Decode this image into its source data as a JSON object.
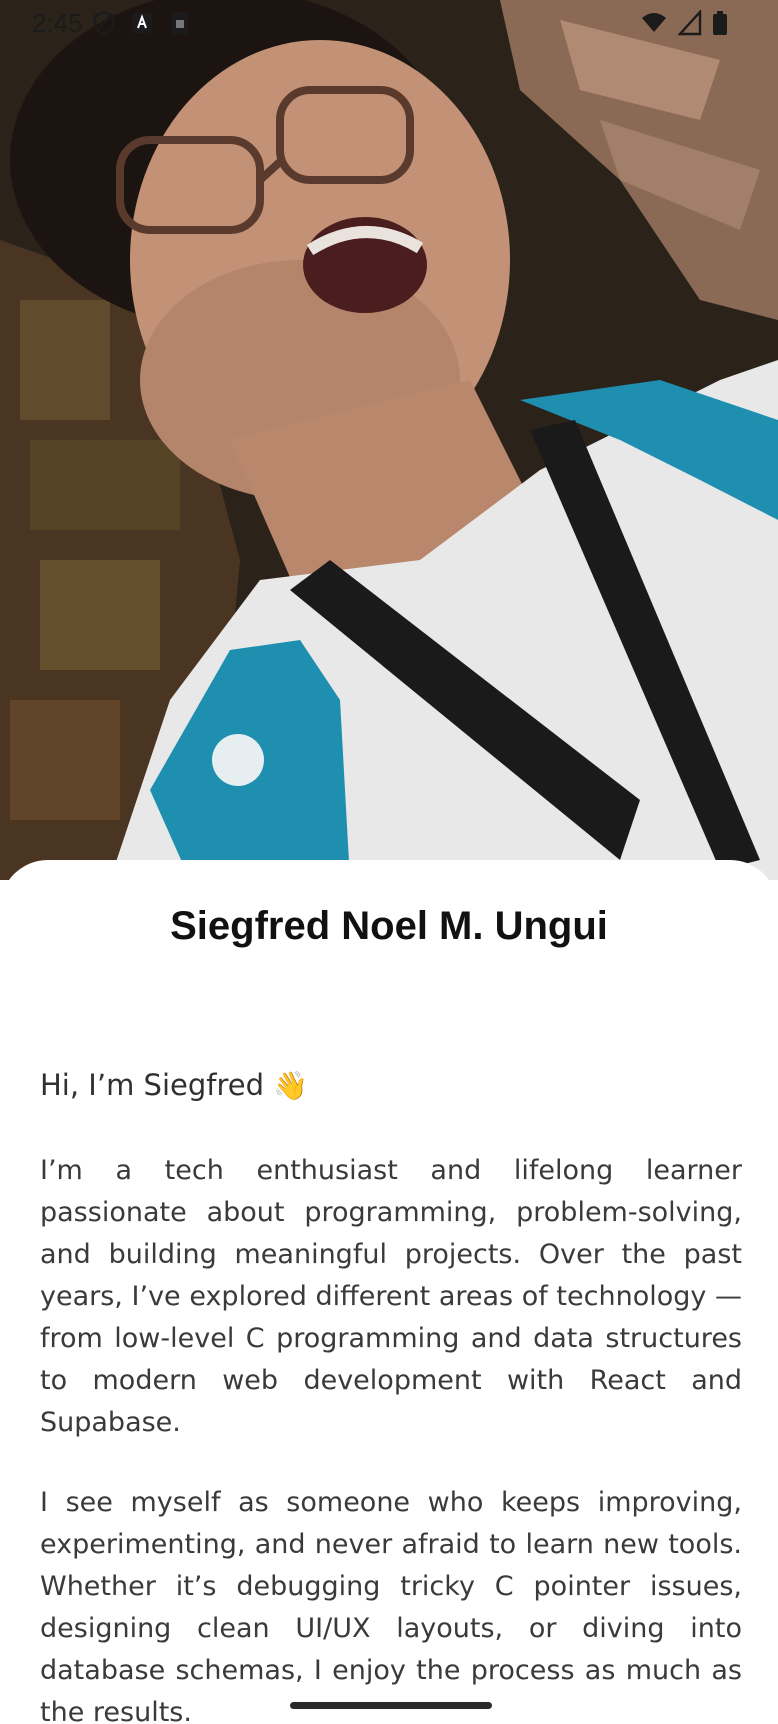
{
  "status_bar": {
    "time": "2:45",
    "left_icons": [
      "shield-icon",
      "app-a-icon",
      "sim-card-icon"
    ],
    "right_icons": [
      "wifi-icon",
      "signal-icon",
      "battery-icon"
    ]
  },
  "profile": {
    "name": "Siegfred Noel M. Ungui",
    "greeting": "Hi, I’m Siegfred",
    "greeting_emoji": "👋",
    "paragraphs": [
      "I’m a tech enthusiast and lifelong learner passionate about programming, problem-solving, and building meaningful projects. Over the past years, I’ve explored different areas of technology — from low-level C programming and data structures to modern web development with React and Supabase.",
      "I see myself as someone who keeps improving, experimenting, and never afraid to learn new tools. Whether it’s debugging tricky C pointer issues, designing clean UI/UX layouts, or diving into database schemas, I enjoy the process as much as the results."
    ]
  },
  "colors": {
    "card_background": "#ffffff",
    "lanyard_teal": "#1f8fb0",
    "text_primary": "#111111",
    "text_body": "#3a3a3a"
  }
}
